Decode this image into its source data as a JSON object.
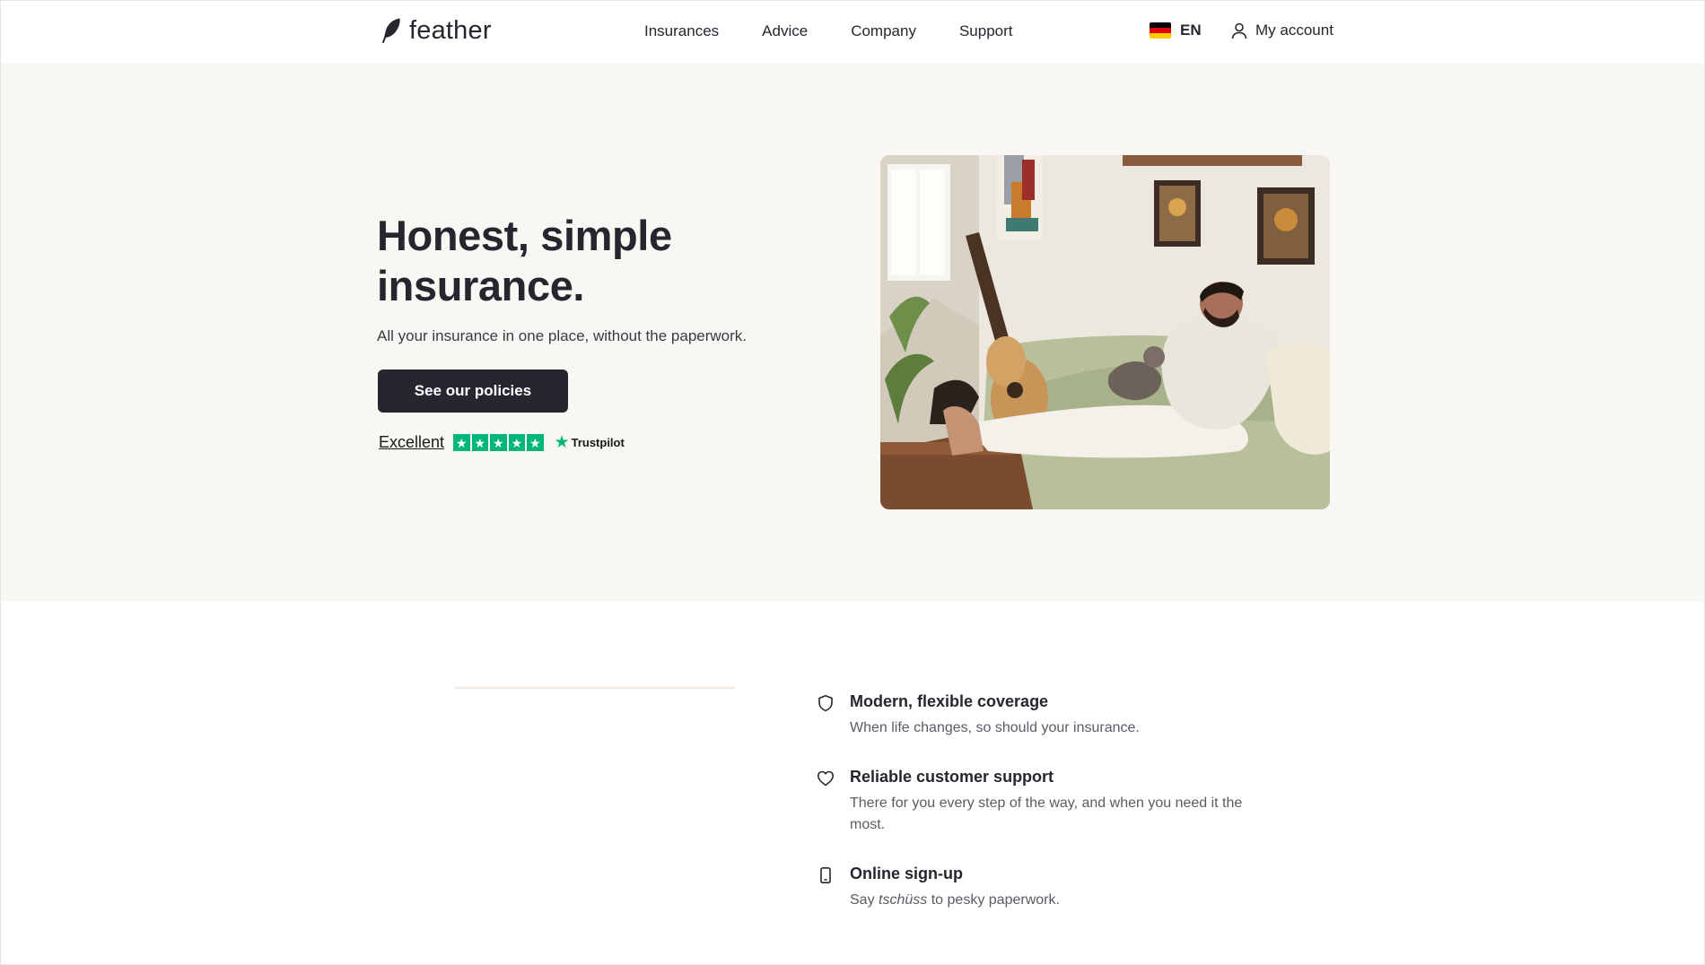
{
  "brand": {
    "name": "feather",
    "icon": "feather-icon"
  },
  "nav": {
    "items": [
      {
        "label": "Insurances"
      },
      {
        "label": "Advice"
      },
      {
        "label": "Company"
      },
      {
        "label": "Support"
      }
    ]
  },
  "language": {
    "code": "EN",
    "flag_icon": "germany-flag-icon"
  },
  "account": {
    "label": "My account",
    "icon": "user-icon"
  },
  "hero": {
    "title": "Honest, simple insurance.",
    "subtitle": "All your insurance in one place, without the paperwork.",
    "cta_label": "See our policies",
    "trustpilot": {
      "rating_text": "Excellent",
      "stars": 5,
      "brand": "Trustpilot"
    },
    "image_alt": "Man relaxing on a sofa with a cat and guitar"
  },
  "features": [
    {
      "icon": "shield-icon",
      "title": "Modern, flexible coverage",
      "description": "When life changes, so should your insurance."
    },
    {
      "icon": "heart-icon",
      "title": "Reliable customer support",
      "description": "There for you every step of the way, and when you need it the most."
    },
    {
      "icon": "phone-icon",
      "title": "Online sign-up",
      "description_prefix": "Say",
      "description_em": "tschüss",
      "description_suffix": "to pesky paperwork."
    }
  ],
  "colors": {
    "text": "#26262e",
    "hero_bg": "#f8f7f4",
    "cta_bg": "#26262e",
    "trustpilot_green": "#00b67a"
  }
}
